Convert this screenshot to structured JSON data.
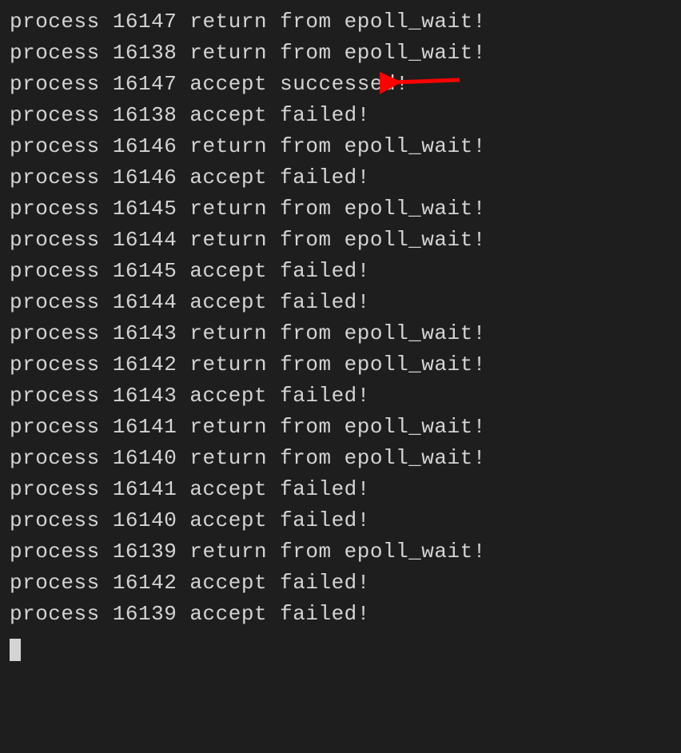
{
  "terminal": {
    "lines": [
      "process 16147 return from epoll_wait!",
      "process 16138 return from epoll_wait!",
      "process 16147 accept successed!",
      "process 16138 accept failed!",
      "process 16146 return from epoll_wait!",
      "process 16146 accept failed!",
      "process 16145 return from epoll_wait!",
      "process 16144 return from epoll_wait!",
      "process 16145 accept failed!",
      "process 16144 accept failed!",
      "process 16143 return from epoll_wait!",
      "process 16142 return from epoll_wait!",
      "process 16143 accept failed!",
      "process 16141 return from epoll_wait!",
      "process 16140 return from epoll_wait!",
      "process 16141 accept failed!",
      "process 16140 accept failed!",
      "process 16139 return from epoll_wait!",
      "process 16142 accept failed!",
      "process 16139 accept failed!"
    ]
  },
  "annotation": {
    "arrow_color": "#ff0000",
    "arrow_target_line": 2
  }
}
